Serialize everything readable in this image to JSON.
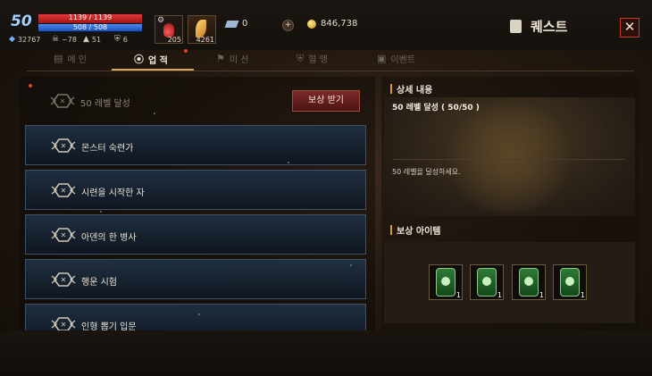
{
  "player": {
    "level": "50",
    "hp_text": "1139 / 1139",
    "mp_text": "508 / 508",
    "hp_fraction": 1.0,
    "mp_fraction": 1.0,
    "stats": [
      {
        "icon": "blue-crystal-icon",
        "value": "32767"
      },
      {
        "icon": "skull-icon",
        "value": "~78"
      },
      {
        "icon": "boot-icon",
        "value": "51"
      },
      {
        "icon": "shield-icon",
        "value": "6"
      }
    ]
  },
  "quick_slots": [
    {
      "icon": "potion-icon",
      "count": "205"
    },
    {
      "icon": "feather-icon",
      "count": "4261"
    }
  ],
  "currency": {
    "tickets": "0",
    "gold": "846,738"
  },
  "window": {
    "title": "퀘스트",
    "close_label": "✕"
  },
  "tabs": [
    {
      "label": "메 인",
      "icon": "scroll-icon",
      "active": false
    },
    {
      "label": "업 적",
      "icon": "medal-icon",
      "active": true
    },
    {
      "label": "미 션",
      "icon": "flag-icon",
      "active": false
    },
    {
      "label": "혈 맹",
      "icon": "crest-icon",
      "active": false
    },
    {
      "label": "이벤트",
      "icon": "gift-icon",
      "active": false
    }
  ],
  "achievements": [
    {
      "label": "50 레벨 달성",
      "completed": true
    },
    {
      "label": "몬스터 숙련가"
    },
    {
      "label": "시련을 시작한 자"
    },
    {
      "label": "아덴의 한 병사"
    },
    {
      "label": "행운 시험"
    },
    {
      "label": "인형 뽑기 입문"
    }
  ],
  "claim_button": "보상 받기",
  "detail": {
    "header": "상세 내용",
    "title": "50 레벨 달성 ( 50/50 )",
    "description": "50 레벨을 달성하세요."
  },
  "reward": {
    "header": "보상 아이템",
    "items": [
      {
        "icon": "green-card-icon",
        "qty": "1"
      },
      {
        "icon": "green-card-icon",
        "qty": "1"
      },
      {
        "icon": "green-card-icon",
        "qty": "1"
      },
      {
        "icon": "green-card-icon",
        "qty": "1"
      }
    ]
  },
  "colors": {
    "hp": "#c41e1e",
    "mp": "#2f6cd8",
    "accent": "#d89a2a",
    "close_border": "#c93a2a"
  }
}
